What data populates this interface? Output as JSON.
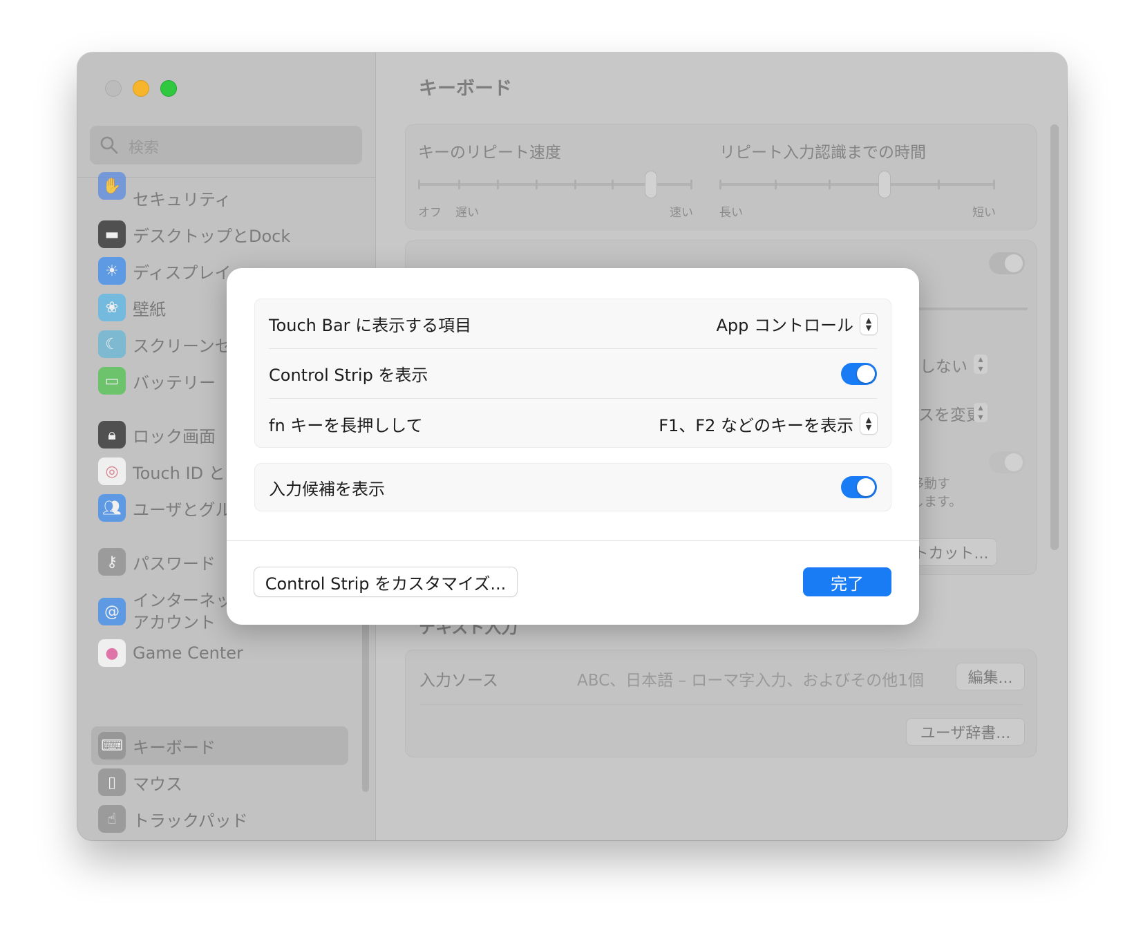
{
  "sidebar": {
    "search_placeholder": "検索",
    "items": [
      {
        "label": "セキュリティ",
        "icon": "hand-icon",
        "color": "#5a8be0"
      },
      {
        "label": "デスクトップとDock",
        "icon": "desktop-dock-icon",
        "color": "#2a2a2a"
      },
      {
        "label": "ディスプレイ",
        "icon": "display-sun-icon",
        "color": "#3d8df0"
      },
      {
        "label": "壁紙",
        "icon": "wallpaper-flower-icon",
        "color": "#5ab8e8"
      },
      {
        "label": "スクリーンセ",
        "icon": "screensaver-icon",
        "color": "#67b7d8"
      },
      {
        "label": "バッテリー",
        "icon": "battery-icon",
        "color": "#4fc44f"
      },
      {
        "label": "ロック画面",
        "icon": "lock-icon",
        "color": "#2a2a2a"
      },
      {
        "label": "Touch ID と",
        "icon": "fingerprint-icon",
        "color": "#e8a0a8"
      },
      {
        "label": "ユーザとグル",
        "icon": "users-icon",
        "color": "#3d8df0"
      },
      {
        "label": "パスワード",
        "icon": "key-icon",
        "color": "#8e8e8e"
      },
      {
        "label": "インターネット\nアカウント",
        "icon": "at-sign-icon",
        "color": "#3d8df0"
      },
      {
        "label": "Game Center",
        "icon": "game-center-icon",
        "color": "#e85aa0"
      },
      {
        "label": "キーボード",
        "icon": "keyboard-icon",
        "color": "#8e8e8e"
      },
      {
        "label": "マウス",
        "icon": "mouse-icon",
        "color": "#8e8e8e"
      },
      {
        "label": "トラックパッド",
        "icon": "trackpad-icon",
        "color": "#8e8e8e"
      }
    ]
  },
  "main": {
    "title": "キーボード",
    "repeat_speed": {
      "label": "キーのリピート速度",
      "min_labels": [
        "オフ",
        "遅い"
      ],
      "max_label": "速い",
      "value_fraction": 0.85
    },
    "repeat_delay": {
      "label": "リピート入力認識までの時間",
      "min_label": "長い",
      "max_label": "短い",
      "value_fraction": 0.6
    },
    "partial": {
      "dropdown1": "しない",
      "dropdown2": "ースを変更",
      "note_line1": "に移動す",
      "note_line2": "劢します。",
      "shortcuts_button": "ートカット..."
    },
    "text_input": {
      "heading": "テキスト入力",
      "source_label": "入力ソース",
      "source_value": "ABC、日本語 – ローマ字入力、およびその他1個",
      "edit_button": "編集...",
      "dictionary_button": "ユーザ辞書..."
    }
  },
  "sheet": {
    "rows": [
      {
        "label": "Touch Bar に表示する項目",
        "value": "App コントロール"
      },
      {
        "label": "Control Strip を表示",
        "toggle": true
      },
      {
        "label": "fn キーを長押しして",
        "value": "F1、F2 などのキーを表示"
      }
    ],
    "suggestions": {
      "label": "入力候補を表示",
      "toggle": true
    },
    "customize_button": "Control Strip をカスタマイズ...",
    "done_button": "完了"
  },
  "colors": {
    "accent": "#1a7cf5",
    "close": "#bdbcbc",
    "minimize": "#f7b52b",
    "maximize": "#2fc840"
  }
}
